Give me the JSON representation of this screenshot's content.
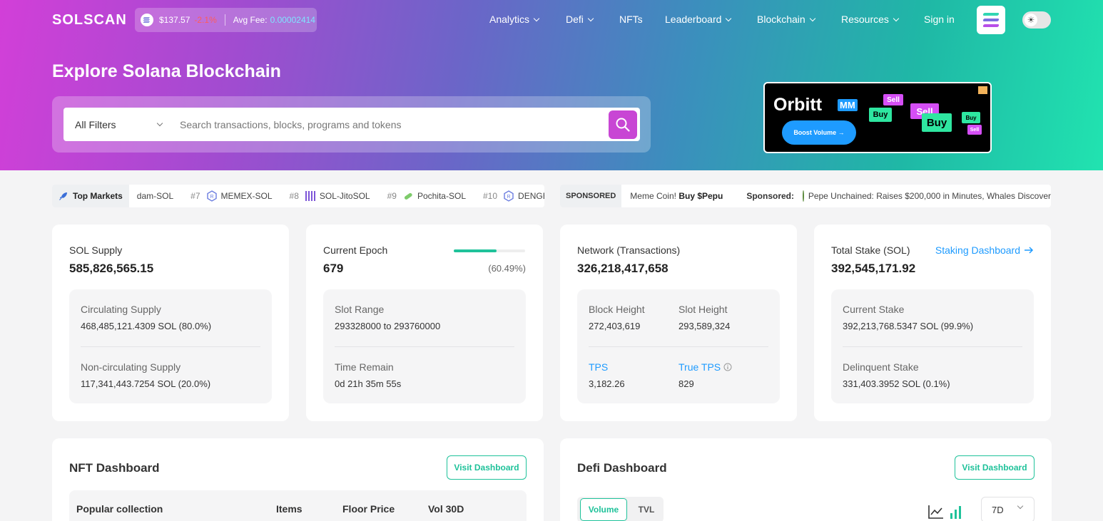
{
  "header": {
    "logo": "SOLSCAN",
    "price": "$137.57",
    "price_change": "-2.1%",
    "fee_label": "Avg Fee:",
    "fee_value": "0.00002414",
    "nav": [
      {
        "label": "Analytics",
        "dropdown": true
      },
      {
        "label": "Defi",
        "dropdown": true
      },
      {
        "label": "NFTs",
        "dropdown": false
      },
      {
        "label": "Leaderboard",
        "dropdown": true
      },
      {
        "label": "Blockchain",
        "dropdown": true
      },
      {
        "label": "Resources",
        "dropdown": true
      },
      {
        "label": "Sign in",
        "dropdown": false
      }
    ]
  },
  "hero": {
    "title": "Explore Solana Blockchain",
    "filter": "All Filters",
    "search_placeholder": "Search transactions, blocks, programs and tokens"
  },
  "ad": {
    "title": "Orbitt",
    "badge": "MM",
    "cta": "Boost Volume",
    "bubbles": [
      "Sell",
      "Buy",
      "Sell",
      "Buy",
      "Buy",
      "Sell"
    ]
  },
  "ticker": {
    "label": "Top Markets",
    "items": [
      {
        "rank": "",
        "name": "dam-SOL"
      },
      {
        "rank": "#7",
        "name": "MEMEX-SOL"
      },
      {
        "rank": "#8",
        "name": "SOL-JitoSOL"
      },
      {
        "rank": "#9",
        "name": "Pochita-SOL"
      },
      {
        "rank": "#10",
        "name": "DENGB"
      }
    ]
  },
  "sponsored": {
    "tag": "SPONSORED",
    "text_plain": "Meme Coin!",
    "text_bold": "Buy $Pepu",
    "label": "Sponsored:",
    "headline": "Pepe Unchained: Raises $200,000 in Minutes, Whales Discover"
  },
  "cards": {
    "supply": {
      "label": "SOL Supply",
      "value": "585,826,565.15",
      "circ_label": "Circulating Supply",
      "circ_value": "468,485,121.4309 SOL (80.0%)",
      "noncirc_label": "Non-circulating Supply",
      "noncirc_value": "117,341,443.7254 SOL (20.0%)"
    },
    "epoch": {
      "label": "Current Epoch",
      "value": "679",
      "progress": 0.6049,
      "pct": "(60.49%)",
      "slot_label": "Slot Range",
      "slot_value": "293328000 to 293760000",
      "time_label": "Time Remain",
      "time_value": "0d 21h 35m 55s"
    },
    "network": {
      "label": "Network (Transactions)",
      "value": "326,218,417,658",
      "block_label": "Block Height",
      "block_value": "272,403,619",
      "slot_label": "Slot Height",
      "slot_value": "293,589,324",
      "tps_label": "TPS",
      "tps_value": "3,182.26",
      "true_tps_label": "True TPS",
      "true_tps_value": "829"
    },
    "stake": {
      "label": "Total Stake (SOL)",
      "link": "Staking Dashboard",
      "value": "392,545,171.92",
      "current_label": "Current Stake",
      "current_value": "392,213,768.5347 SOL (99.9%)",
      "delinq_label": "Delinquent Stake",
      "delinq_value": "331,403.3952 SOL (0.1%)"
    }
  },
  "nft_dashboard": {
    "title": "NFT Dashboard",
    "button": "Visit Dashboard",
    "columns": [
      "Popular collection",
      "Items",
      "Floor Price",
      "Vol 30D"
    ]
  },
  "defi_dashboard": {
    "title": "Defi Dashboard",
    "button": "Visit Dashboard",
    "tabs": [
      "Volume",
      "TVL"
    ],
    "period": "7D"
  },
  "colors": {
    "accent": "#1fc29a",
    "link": "#1e9bff",
    "search_button": "#c846d4"
  }
}
